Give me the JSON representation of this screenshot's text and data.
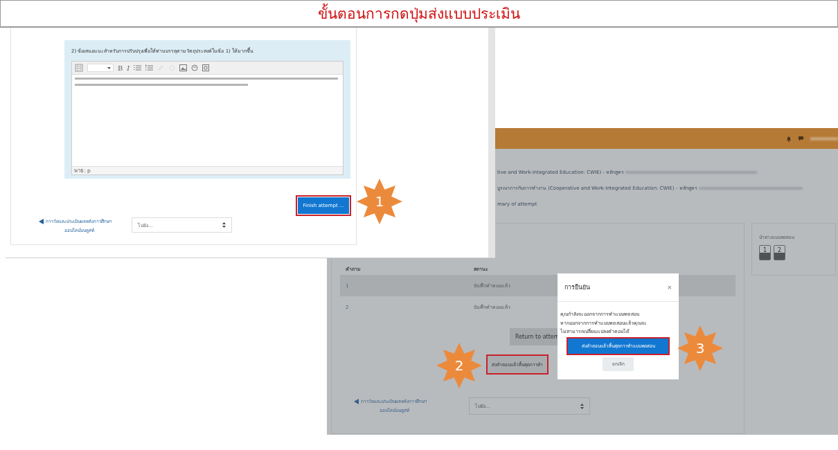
{
  "title": "ขั้นตอนการกดปุ่มส่งแบบประเมิน",
  "form_panel": {
    "question": "2) ข้อเสนอแนะสำหรับการปรับปรุงเพื่อให้ท่านบรรลุตามวัตถุประสงค์ในข้อ 1) ให้มากขึ้น",
    "editor": {
      "bold": "B",
      "italic": "I",
      "path": "พาธ: p"
    },
    "finish_button": "Finish attempt ...",
    "step": "1",
    "nav_link_lines": [
      "การวัดและประเมินผลหลังการศึกษา",
      "ออนไลน์บนลูสท์"
    ],
    "jump_select": "ไปยัง..."
  },
  "summary_panel": {
    "breadcrumbs": [
      "tive and Work-Integrated Education: CWIE) - หลักสูตร",
      "บูรณาการกับการทำงาน (Cooperative and Work-Integrated Education: CWIE) - หลักสูตร",
      "mary of attempt"
    ],
    "table": {
      "columns": [
        "คำถาม",
        "สถานะ"
      ],
      "rows": [
        {
          "question": "1",
          "status": "บันทึกคำตอบแล้ว"
        },
        {
          "question": "2",
          "status": "บันทึกคำตอบแล้ว"
        }
      ]
    },
    "return_button": "Return to attem",
    "submit_button": "ส่งคำตอบแล้วสิ้นสุดการทำ",
    "step": "2",
    "nav_link_lines": [
      "การวัดและประเมินผลหลังการศึกษา",
      "ออนไลน์บนลูสท์"
    ],
    "jump_select": "ไปยัง...",
    "quiz_nav": {
      "title": "นำทางแบบทดสอบ",
      "questions": [
        "1",
        "2"
      ]
    }
  },
  "dialog": {
    "title": "การยืนยัน",
    "close": "×",
    "message_lines": [
      "คุณกำลังจะออกจากการทำแบบทดสอบ",
      "หากออกจากการทำแบบทดสอบแล้วคุณจะ",
      "ไม่สามารถเปลี่ยนแปลงคำตอบได้"
    ],
    "confirm_button": "ส่งคำตอบแล้วสิ้นสุดการทำแบบทดสอบ",
    "cancel_button": "ยกเลิก",
    "step": "3"
  }
}
